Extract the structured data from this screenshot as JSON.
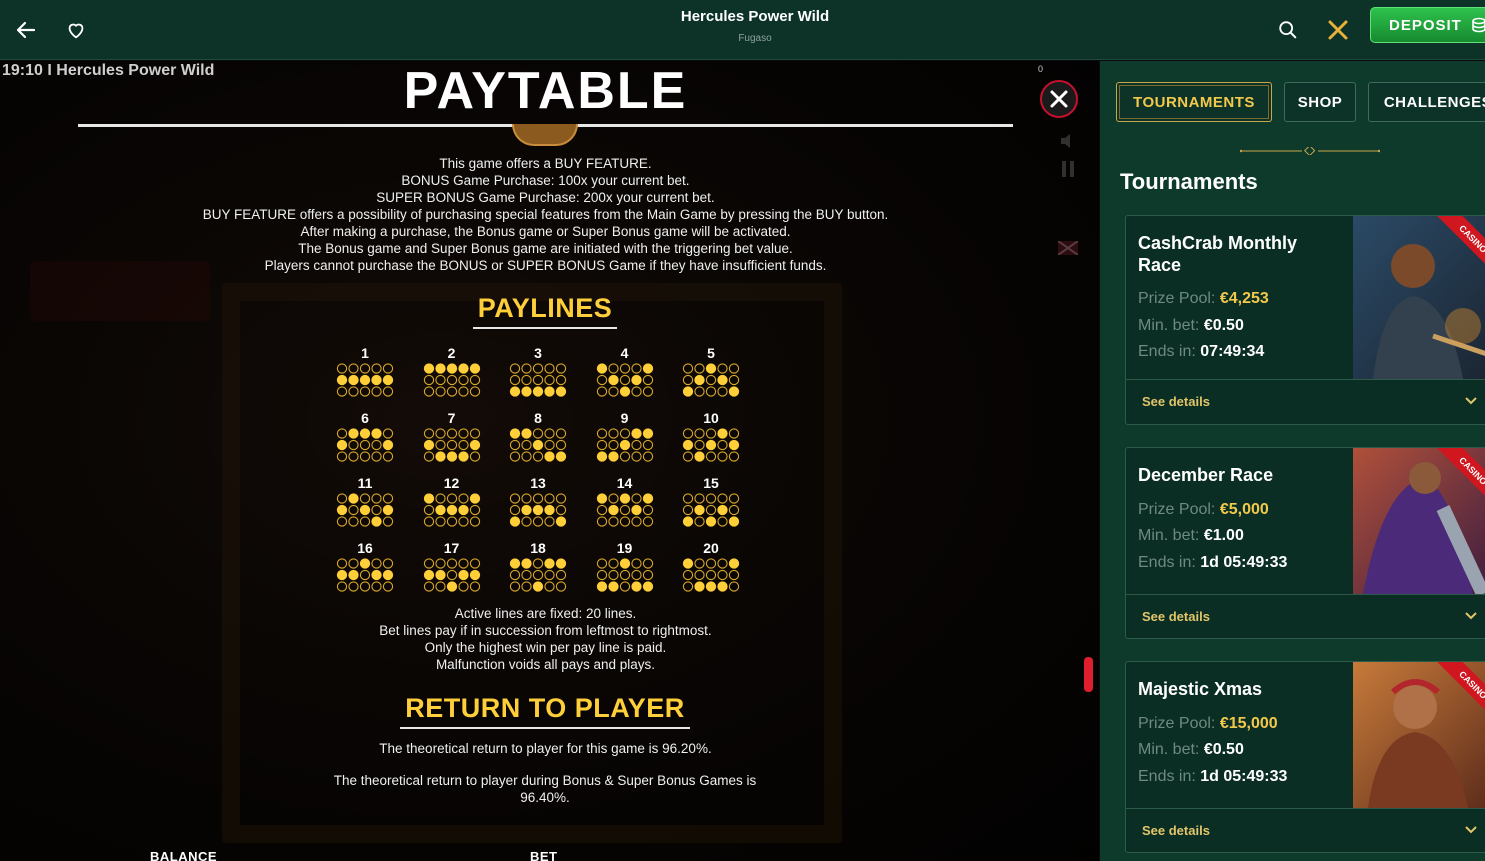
{
  "topbar": {
    "title": "Hercules Power Wild",
    "provider": "Fugaso",
    "deposit_label": "DEPOSIT",
    "icons": [
      "back-arrow-icon",
      "heart-icon",
      "search-icon",
      "close-icon",
      "coins-icon"
    ]
  },
  "game": {
    "time_title": "19:10 I Hercules Power Wild",
    "counter": "0",
    "paytable_title": "PAYTABLE",
    "buy_feature_text": [
      "This game offers a BUY FEATURE.",
      "BONUS Game Purchase: 100x your current bet.",
      "SUPER BONUS Game Purchase: 200x your current bet.",
      "BUY FEATURE offers a possibility of purchasing special features from the Main Game by pressing the BUY button.",
      "After making a purchase, the Bonus game or Super Bonus game will be activated.",
      "The Bonus game and Super Bonus game are initiated with the triggering bet value.",
      "Players cannot purchase the BONUS or SUPER BONUS Game if they have insufficient funds."
    ],
    "paylines_heading": "PAYLINES",
    "paylines": [
      {
        "n": "1",
        "rows": [
          1,
          1,
          1,
          1,
          1
        ]
      },
      {
        "n": "2",
        "rows": [
          0,
          0,
          0,
          0,
          0
        ]
      },
      {
        "n": "3",
        "rows": [
          2,
          2,
          2,
          2,
          2
        ]
      },
      {
        "n": "4",
        "rows": [
          0,
          1,
          2,
          1,
          0
        ]
      },
      {
        "n": "5",
        "rows": [
          2,
          1,
          0,
          1,
          2
        ]
      },
      {
        "n": "6",
        "rows": [
          1,
          0,
          0,
          0,
          1
        ]
      },
      {
        "n": "7",
        "rows": [
          1,
          2,
          2,
          2,
          1
        ]
      },
      {
        "n": "8",
        "rows": [
          0,
          0,
          1,
          2,
          2
        ]
      },
      {
        "n": "9",
        "rows": [
          2,
          2,
          1,
          0,
          0
        ]
      },
      {
        "n": "10",
        "rows": [
          1,
          2,
          1,
          0,
          1
        ]
      },
      {
        "n": "11",
        "rows": [
          1,
          0,
          1,
          2,
          1
        ]
      },
      {
        "n": "12",
        "rows": [
          0,
          1,
          1,
          1,
          0
        ]
      },
      {
        "n": "13",
        "rows": [
          2,
          1,
          1,
          1,
          2
        ]
      },
      {
        "n": "14",
        "rows": [
          0,
          1,
          0,
          1,
          0
        ]
      },
      {
        "n": "15",
        "rows": [
          2,
          1,
          2,
          1,
          2
        ]
      },
      {
        "n": "16",
        "rows": [
          1,
          1,
          0,
          1,
          1
        ]
      },
      {
        "n": "17",
        "rows": [
          1,
          1,
          2,
          1,
          1
        ]
      },
      {
        "n": "18",
        "rows": [
          0,
          0,
          2,
          0,
          0
        ]
      },
      {
        "n": "19",
        "rows": [
          2,
          2,
          0,
          2,
          2
        ]
      },
      {
        "n": "20",
        "rows": [
          0,
          2,
          2,
          2,
          0
        ]
      }
    ],
    "paylines_text": [
      "Active lines are fixed: 20 lines.",
      "Bet lines pay if in succession from leftmost to rightmost.",
      "Only the highest win per pay line is paid.",
      "Malfunction voids all pays and plays."
    ],
    "rtp_heading": "RETURN TO PLAYER",
    "rtp_text_1": "The theoretical return to player for this game is 96.20%.",
    "rtp_text_2": "The theoretical return to player during Bonus & Super Bonus Games is 96.40%.",
    "balance_label": "BALANCE",
    "bet_label": "BET",
    "colors": {
      "gold": "#ffcf3a",
      "close_ring": "#c8102e"
    }
  },
  "sidebar": {
    "tabs": [
      "TOURNAMENTS",
      "SHOP",
      "CHALLENGES"
    ],
    "active_tab": "TOURNAMENTS",
    "title": "Tournaments",
    "prize_label": "Prize Pool:",
    "minbet_label": "Min. bet:",
    "ends_label": "Ends in:",
    "see_details": "See details",
    "badge": "CASINO",
    "tournaments": [
      {
        "name": "CashCrab Monthly Race",
        "prize": "€4,253",
        "min_bet": "€0.50",
        "ends": "07:49:34"
      },
      {
        "name": "December Race",
        "prize": "€5,000",
        "min_bet": "€1.00",
        "ends": "1d 05:49:33"
      },
      {
        "name": "Majestic Xmas",
        "prize": "€15,000",
        "min_bet": "€0.50",
        "ends": "1d 05:49:33"
      }
    ],
    "colors": {
      "bg": "#0e3a2c",
      "accent_gold": "#f2c94c",
      "badge_red": "#d0161f"
    }
  }
}
